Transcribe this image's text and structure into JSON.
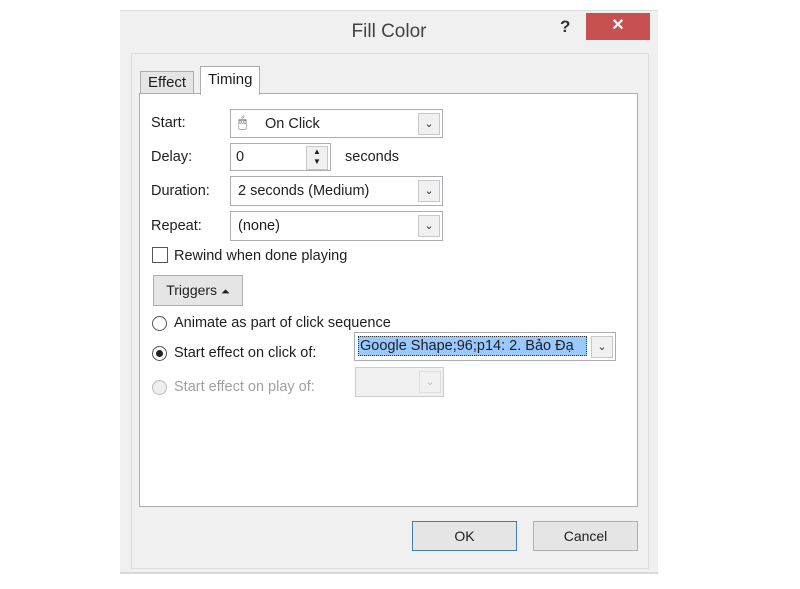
{
  "dialog": {
    "title": "Fill Color",
    "help": "?",
    "close": "✕"
  },
  "tabs": [
    {
      "label": "Effect",
      "active": false
    },
    {
      "label": "Timing",
      "active": true
    }
  ],
  "timing": {
    "start": {
      "label": "Start:",
      "value": "On Click",
      "icon": "mouse-icon"
    },
    "delay": {
      "label": "Delay:",
      "value": "0",
      "unit": "seconds"
    },
    "duration": {
      "label": "Duration:",
      "value": "2 seconds (Medium)"
    },
    "repeat": {
      "label": "Repeat:",
      "value": "(none)"
    },
    "rewind": {
      "label": "Rewind when done playing",
      "checked": false
    },
    "triggers": {
      "label": "Triggers",
      "icon": "double-chevron-up-icon"
    },
    "options": [
      {
        "label": "Animate as part of click sequence",
        "selected": false,
        "enabled": true
      },
      {
        "label": "Start effect on click of:",
        "selected": true,
        "enabled": true,
        "value": "Google Shape;96;p14: 2. Bảo Đạ"
      },
      {
        "label": "Start effect on play of:",
        "selected": false,
        "enabled": false,
        "value": ""
      }
    ]
  },
  "buttons": {
    "ok": "OK",
    "cancel": "Cancel"
  },
  "colors": {
    "close": "#c75050",
    "selection": "#99c9ff",
    "ok_border": "#3c7fb1"
  }
}
